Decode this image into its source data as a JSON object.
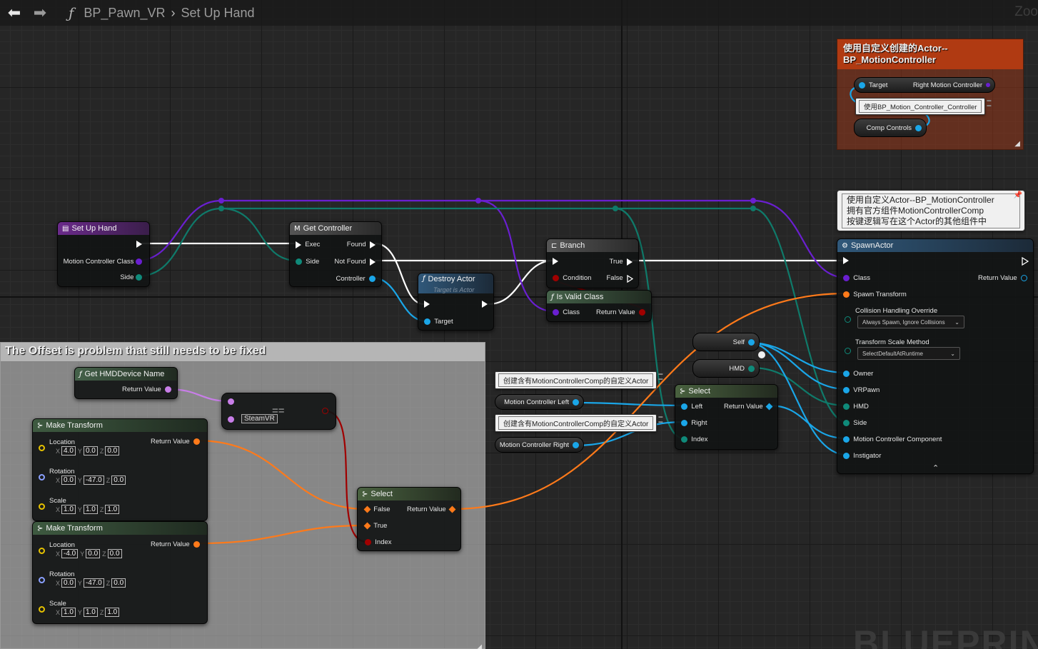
{
  "toolbar": {
    "blueprint_name": "BP_Pawn_VR",
    "function_name": "Set Up Hand",
    "zoom_label": "Zoo"
  },
  "watermark": "BLUEPRIN",
  "comments": {
    "offset": "The Offset is problem that still needs to be fixed",
    "custom_actor": "使用自定义创建的Actor--BP_MotionController",
    "spawn_note": "使用自定义Actor--BP_MotionController\n拥有官方组件MotionControllerComp\n按键逻辑写在这个Actor的其他组件中"
  },
  "nodes": {
    "setup_hand": {
      "title": "Set Up Hand",
      "pins": [
        "Motion Controller Class",
        "Side"
      ]
    },
    "get_controller": {
      "title": "Get Controller",
      "pins": {
        "exec": "Exec",
        "side": "Side",
        "found": "Found",
        "not_found": "Not Found",
        "controller": "Controller"
      }
    },
    "destroy_actor": {
      "title": "Destroy Actor",
      "subtitle": "Target is Actor",
      "pins": {
        "target": "Target"
      }
    },
    "branch": {
      "title": "Branch",
      "pins": {
        "condition": "Condition",
        "true": "True",
        "false": "False"
      }
    },
    "is_valid_class": {
      "title": "Is Valid Class",
      "pins": {
        "class": "Class",
        "return": "Return Value"
      }
    },
    "spawn_actor": {
      "title": "SpawnActor",
      "pins": {
        "class": "Class",
        "return": "Return Value",
        "spawn_transform": "Spawn Transform",
        "collision": "Collision Handling Override",
        "scale_method": "Transform Scale Method",
        "owner": "Owner",
        "vrpawn": "VRPawn",
        "hmd": "HMD",
        "side": "Side",
        "mcc": "Motion Controller Component",
        "instigator": "Instigator"
      },
      "collision_value": "Always Spawn, Ignore Collisions",
      "scale_value": "SelectDefaultAtRuntime"
    },
    "get_hmd": {
      "title": "Get HMDDevice Name",
      "return": "Return Value"
    },
    "equal": {
      "symbol": "==",
      "value": "SteamVR"
    },
    "make_transform_1": {
      "title": "Make Transform",
      "return": "Return Value",
      "location_label": "Location",
      "location": [
        "4.0",
        "0.0",
        "0.0"
      ],
      "rotation_label": "Rotation",
      "rotation": [
        "0.0",
        "-47.0",
        "0.0"
      ],
      "scale_label": "Scale",
      "scale": [
        "1.0",
        "1.0",
        "1.0"
      ]
    },
    "make_transform_2": {
      "title": "Make Transform",
      "return": "Return Value",
      "location_label": "Location",
      "location": [
        "-4.0",
        "0.0",
        "0.0"
      ],
      "rotation_label": "Rotation",
      "rotation": [
        "0.0",
        "-47.0",
        "0.0"
      ],
      "scale_label": "Scale",
      "scale": [
        "1.0",
        "1.0",
        "1.0"
      ]
    },
    "select_transform": {
      "title": "Select",
      "pins": {
        "false": "False",
        "true": "True",
        "index": "Index",
        "return": "Return Value"
      }
    },
    "select_controller": {
      "title": "Select",
      "pins": {
        "left": "Left",
        "right": "Right",
        "index": "Index",
        "return": "Return Value"
      }
    },
    "axis": {
      "x": "X",
      "y": "Y",
      "z": "Z"
    }
  },
  "reroutes": {
    "self": "Self",
    "hmd": "HMD",
    "mc_left": "Motion Controller Left",
    "mc_right": "Motion Controller Right",
    "target": "Target",
    "right_mc": "Right Motion Controller",
    "comp_controls": "Comp Controls"
  },
  "notes": {
    "create_left": "创建含有MotionControllerComp的自定义Actor",
    "create_right": "创建含有MotionControllerComp的自定义Actor",
    "bp_note": "使用BP_Motion_Controller_Controller"
  },
  "colors": {
    "exec": "#ffffff",
    "class_pin": "#6a1fd0",
    "object_pin": "#1aa6e8",
    "transform_pin": "#ff7a1a",
    "enum_pin": "#0f8a7a",
    "bool_pin": "#a00000",
    "name_pin": "#c87ee8",
    "vector_pin": "#e6c200",
    "comment_orange": "#b03a12"
  }
}
